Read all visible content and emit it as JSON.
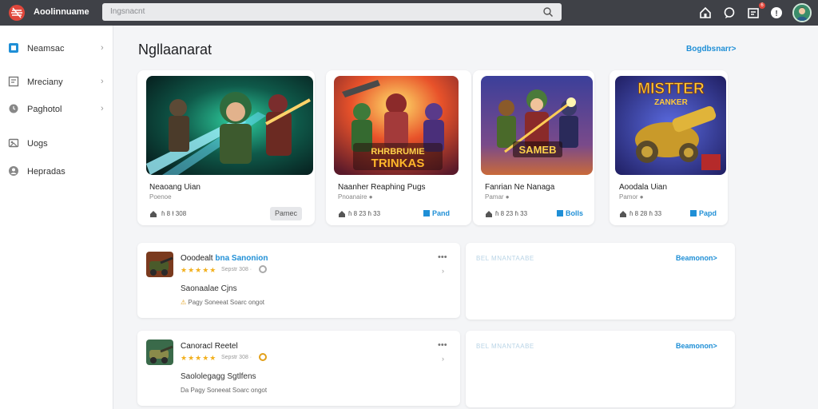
{
  "header": {
    "brand": "Aoolinnuame",
    "search_placeholder": "Ingsnacnt"
  },
  "sidebar": {
    "items": [
      {
        "label": "Neamsac",
        "icon": "square-icon",
        "chevron": "›"
      },
      {
        "label": "Mreciany",
        "icon": "document-icon",
        "chevron": "›"
      },
      {
        "label": "Paghotol",
        "icon": "clock-icon",
        "chevron": "›"
      },
      {
        "label": "Uogs",
        "icon": "image-icon",
        "chevron": ""
      },
      {
        "label": "Hepradas",
        "icon": "user-icon",
        "chevron": ""
      }
    ]
  },
  "main": {
    "title": "Ngllaanarat",
    "see_more": "Bogdbsnarr>"
  },
  "games": [
    {
      "title": "Neaoang Uian",
      "sub": "Poenoe",
      "stat": "ɦ 8 Ɨ 308",
      "button": "Pamec"
    },
    {
      "title": "Naanher Reaphing Pugs",
      "sub": "Pnoanaire ●",
      "stat": "ɦ 8 23 ɦ 33",
      "button": "Pand",
      "art_text_1": "RHRBRUMIE",
      "art_text_2": "TRINKAS"
    },
    {
      "title": "Fanrian Ne Nanaga",
      "sub": "Pamar ●",
      "stat": "ɦ 8 23 ɦ 33",
      "button": "Bolls",
      "art_text": "SAMEB"
    },
    {
      "title": "Aoodala Uian",
      "sub": "Pamor ●",
      "stat": "ɦ 8 28 ɦ 33",
      "button": "Papd",
      "art_text_1": "MISTTER",
      "art_text_2": "ZANKER"
    }
  ],
  "reviews": [
    {
      "name": "Ooodealt",
      "name_hl": "bna Sanonion",
      "stars": "★★★★★",
      "meta": "Sepstr 308 ·",
      "line1": "Saonaalae Cjns",
      "line2_icon": "⚠",
      "line2": "Pagy Soneeat Soarc ongot"
    },
    {
      "name": "Canoracl Reetel",
      "name_hl": "",
      "stars": "★★★★★",
      "meta": "Sepstr 308 ·",
      "line1": "Saololegagg Sgtlfens",
      "line2_icon": "",
      "line2": "Da Pagy Soneeat Soarc ongot"
    }
  ],
  "side_panels": [
    {
      "label": "BEL MNANTAABE",
      "link": "Beamonon>"
    },
    {
      "label": "BEL MNANTAABE",
      "link": "Beamonon>"
    }
  ],
  "colors": {
    "topbar": "#3f4147",
    "accent": "#1f8fd6",
    "star": "#f2b01e",
    "notification": "#e0473c"
  }
}
